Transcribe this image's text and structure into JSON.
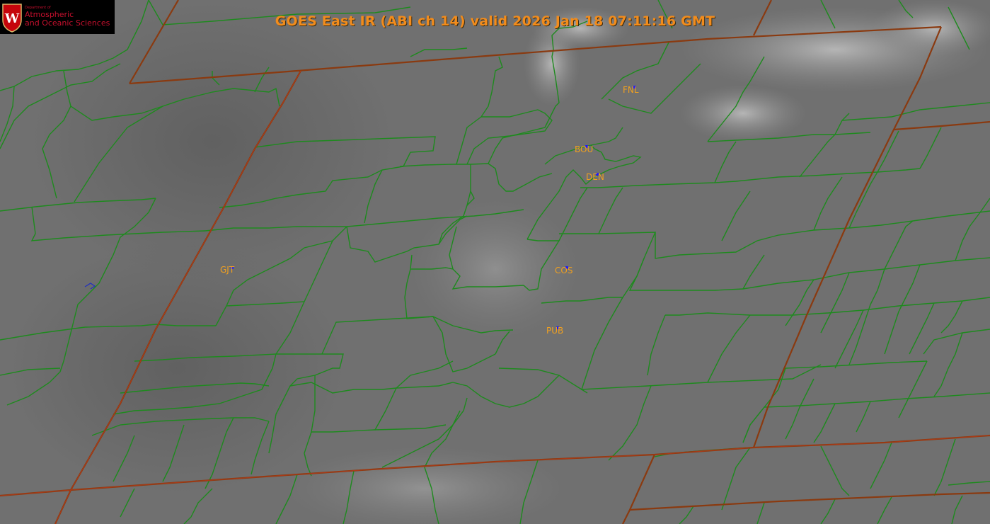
{
  "title": "GOES East IR (ABI ch 14) valid 2026 Jan 18 07:11:16 GMT",
  "logo": {
    "small_text": "Department of",
    "line1": "Atmospheric",
    "line2": "and Oceanic Sciences"
  },
  "stations": [
    {
      "id": "fnl",
      "label": "FNL"
    },
    {
      "id": "bou",
      "label": "BOU"
    },
    {
      "id": "den",
      "label": "DEN"
    },
    {
      "id": "gjt",
      "label": "GJT"
    },
    {
      "id": "cos",
      "label": "COS"
    },
    {
      "id": "pub",
      "label": "PUB"
    }
  ],
  "colors": {
    "background": "#6e6e6e",
    "county_lines": "#1e8a1e",
    "state_lines": "#8a3a10",
    "title": "#f28c1c",
    "station_label": "#f0a020",
    "station_marker": "#1a1aff"
  }
}
